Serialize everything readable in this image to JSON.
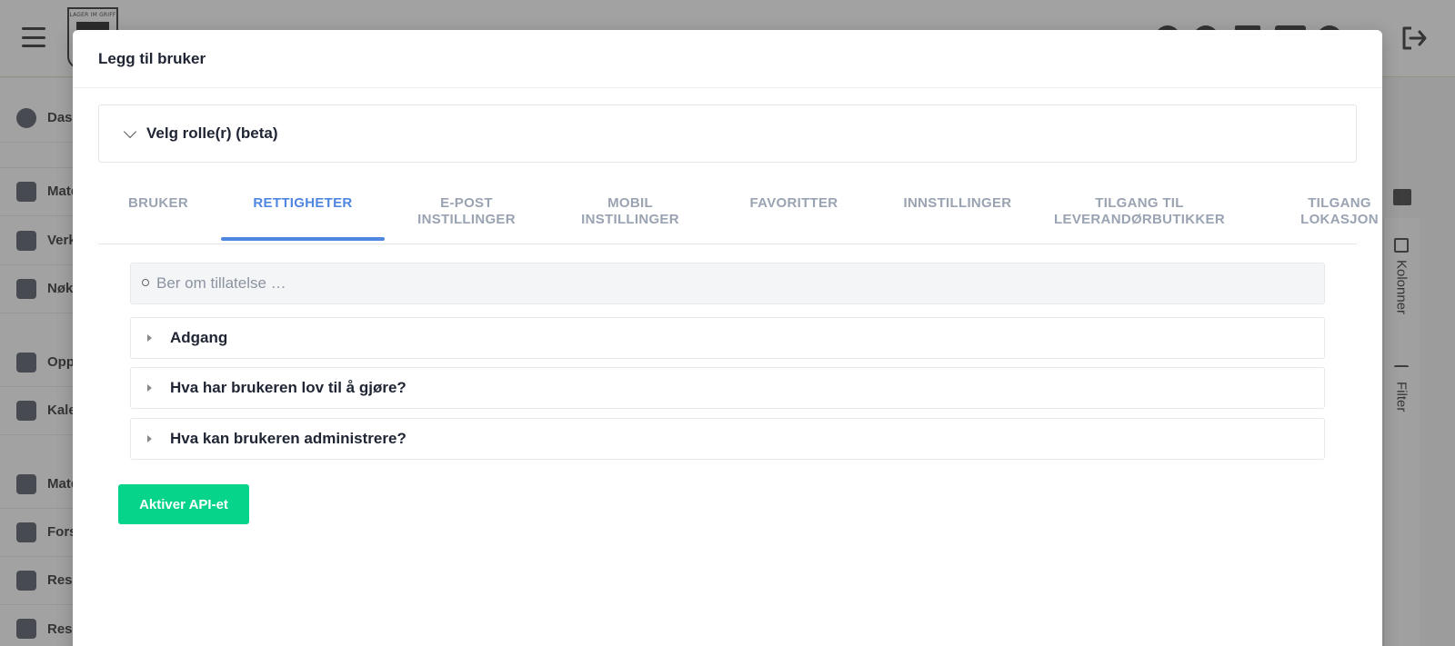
{
  "header": {
    "logo_text": "LAGER IM GRIFF"
  },
  "sidebar": {
    "items": [
      {
        "label": "Das",
        "icon": "dashboard-icon"
      },
      {
        "label": "Mate",
        "icon": "cart-icon"
      },
      {
        "label": "Verk",
        "icon": "tools-icon"
      },
      {
        "label": "Nøk",
        "icon": "key-icon"
      },
      {
        "label": "Opp",
        "icon": "clipboard-icon"
      },
      {
        "label": "Kale",
        "icon": "calendar-icon"
      },
      {
        "label": "Mate",
        "icon": "shelf-icon"
      },
      {
        "label": "Fors",
        "icon": "truck-icon"
      },
      {
        "label": "Res",
        "icon": "layers-icon"
      },
      {
        "label": "Res",
        "icon": "checklist-icon"
      }
    ]
  },
  "right_panel": {
    "columns_label": "Kolonner",
    "filter_label": "Filter"
  },
  "modal": {
    "title": "Legg til bruker",
    "role_select": {
      "label": "Velg rolle(r) (beta)"
    },
    "tabs": [
      {
        "line1": "BRUKER",
        "line2": ""
      },
      {
        "line1": "RETTIGHETER",
        "line2": ""
      },
      {
        "line1": "E-POST",
        "line2": "INSTILLINGER"
      },
      {
        "line1": "MOBIL",
        "line2": "INSTILLINGER"
      },
      {
        "line1": "FAVORITTER",
        "line2": ""
      },
      {
        "line1": "INNSTILLINGER",
        "line2": ""
      },
      {
        "line1": "TILGANG TIL",
        "line2": "LEVERANDØRBUTIKKER"
      },
      {
        "line1": "TILGANG",
        "line2": "LOKASJON"
      }
    ],
    "active_tab": "RETTIGHETER",
    "search": {
      "placeholder": "Ber om tillatelse …",
      "value": ""
    },
    "sections": [
      {
        "label": "Adgang"
      },
      {
        "label": "Hva har brukeren lov til å gjøre?"
      },
      {
        "label": "Hva kan brukeren administrere?"
      }
    ],
    "activate_api_label": "Aktiver API-et"
  },
  "colors": {
    "accent": "#4f86e0",
    "api_button": "#06d48a",
    "tab_inactive": "#9aa3b2"
  }
}
